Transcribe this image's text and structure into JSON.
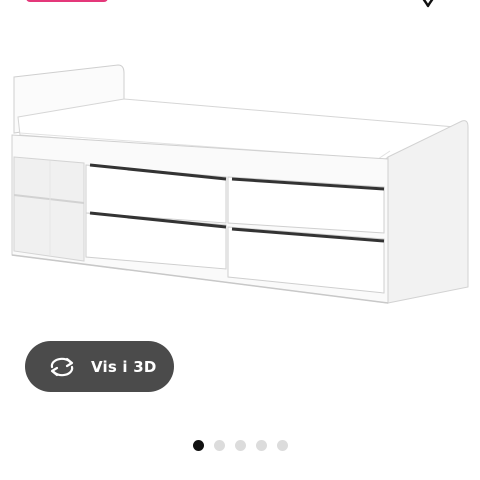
{
  "button_3d": {
    "label": "Vis i 3D",
    "icon": "rotate-360-icon"
  },
  "carousel": {
    "total": 5,
    "active_index": 0
  },
  "colors": {
    "badge": "#e4387a",
    "button_bg": "#4b4b4b",
    "dot_active": "#111111",
    "dot_inactive": "#dcdcdc"
  },
  "favorite": {
    "icon": "heart-icon"
  },
  "product_image": {
    "subject": "white-bed-frame-with-drawers-and-shelves"
  }
}
